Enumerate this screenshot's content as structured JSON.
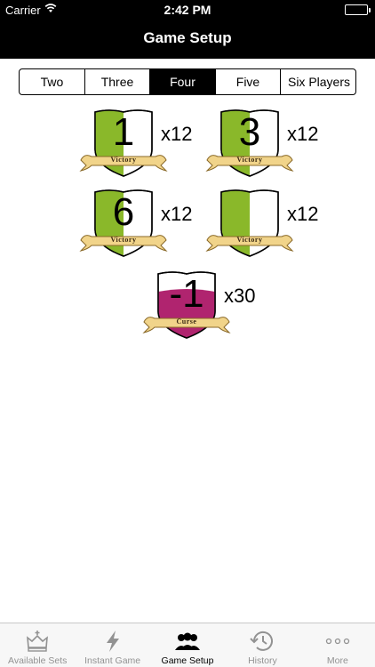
{
  "status": {
    "carrier": "Carrier",
    "time": "2:42 PM"
  },
  "nav": {
    "title": "Game Setup"
  },
  "players": {
    "options": [
      "Two",
      "Three",
      "Four",
      "Five",
      "Six Players"
    ],
    "selected": "Four"
  },
  "cards": [
    {
      "number": "1",
      "count": "x12",
      "label": "Victory",
      "type": "victory"
    },
    {
      "number": "3",
      "count": "x12",
      "label": "Victory",
      "type": "victory"
    },
    {
      "number": "6",
      "count": "x12",
      "label": "Victory",
      "type": "victory"
    },
    {
      "number": "",
      "count": "x12",
      "label": "Victory",
      "type": "victory"
    },
    {
      "number": "-1",
      "count": "x30",
      "label": "Curse",
      "type": "curse"
    }
  ],
  "tabs": [
    {
      "label": "Available Sets",
      "icon": "crown-icon"
    },
    {
      "label": "Instant Game",
      "icon": "lightning-icon"
    },
    {
      "label": "Game Setup",
      "icon": "people-icon",
      "active": true
    },
    {
      "label": "History",
      "icon": "clock-history-icon"
    },
    {
      "label": "More",
      "icon": "more-dots-icon"
    }
  ],
  "colors": {
    "victory": "#8ab82a",
    "curse": "#b0246f",
    "banner": "#f1d48a"
  }
}
